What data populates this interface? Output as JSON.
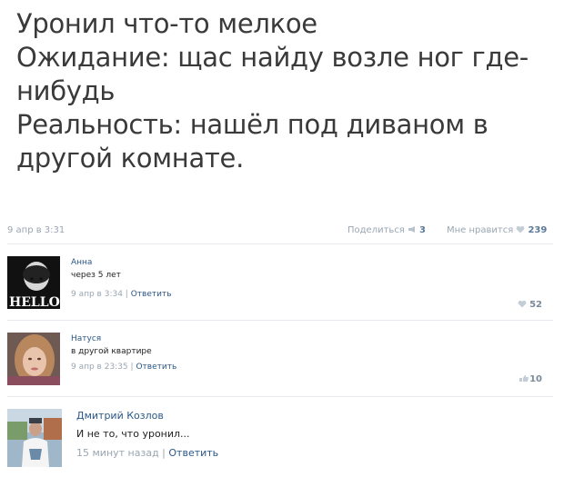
{
  "post": {
    "lines": [
      "Уронил что-то мелкое",
      "Ожидание: щас найду возле ног где-",
      "нибудь",
      "Реальность: нашёл под диваном в",
      "другой комнате."
    ],
    "date": "9 апр в 3:31",
    "share_label": "Поделиться",
    "share_count": "3",
    "like_label": "Мне нравится",
    "like_count": "239"
  },
  "comments": [
    {
      "author": "Анна",
      "text": "через 5 лет",
      "time": "9 апр в 3:34",
      "reply": "Ответить",
      "likes": "52",
      "avatar_text": "HELLO"
    },
    {
      "author": "Натуся",
      "text": "в другой квартире",
      "time": "9 апр в 23:35",
      "reply": "Ответить",
      "likes": "10"
    },
    {
      "author": "Дмитрий Козлов",
      "text": "И не то, что уронил...",
      "time": "15 минут назад",
      "reply": "Ответить"
    }
  ],
  "colors": {
    "link": "#2b5788",
    "muted": "#9aa6b2",
    "text": "#3a3a3a"
  }
}
